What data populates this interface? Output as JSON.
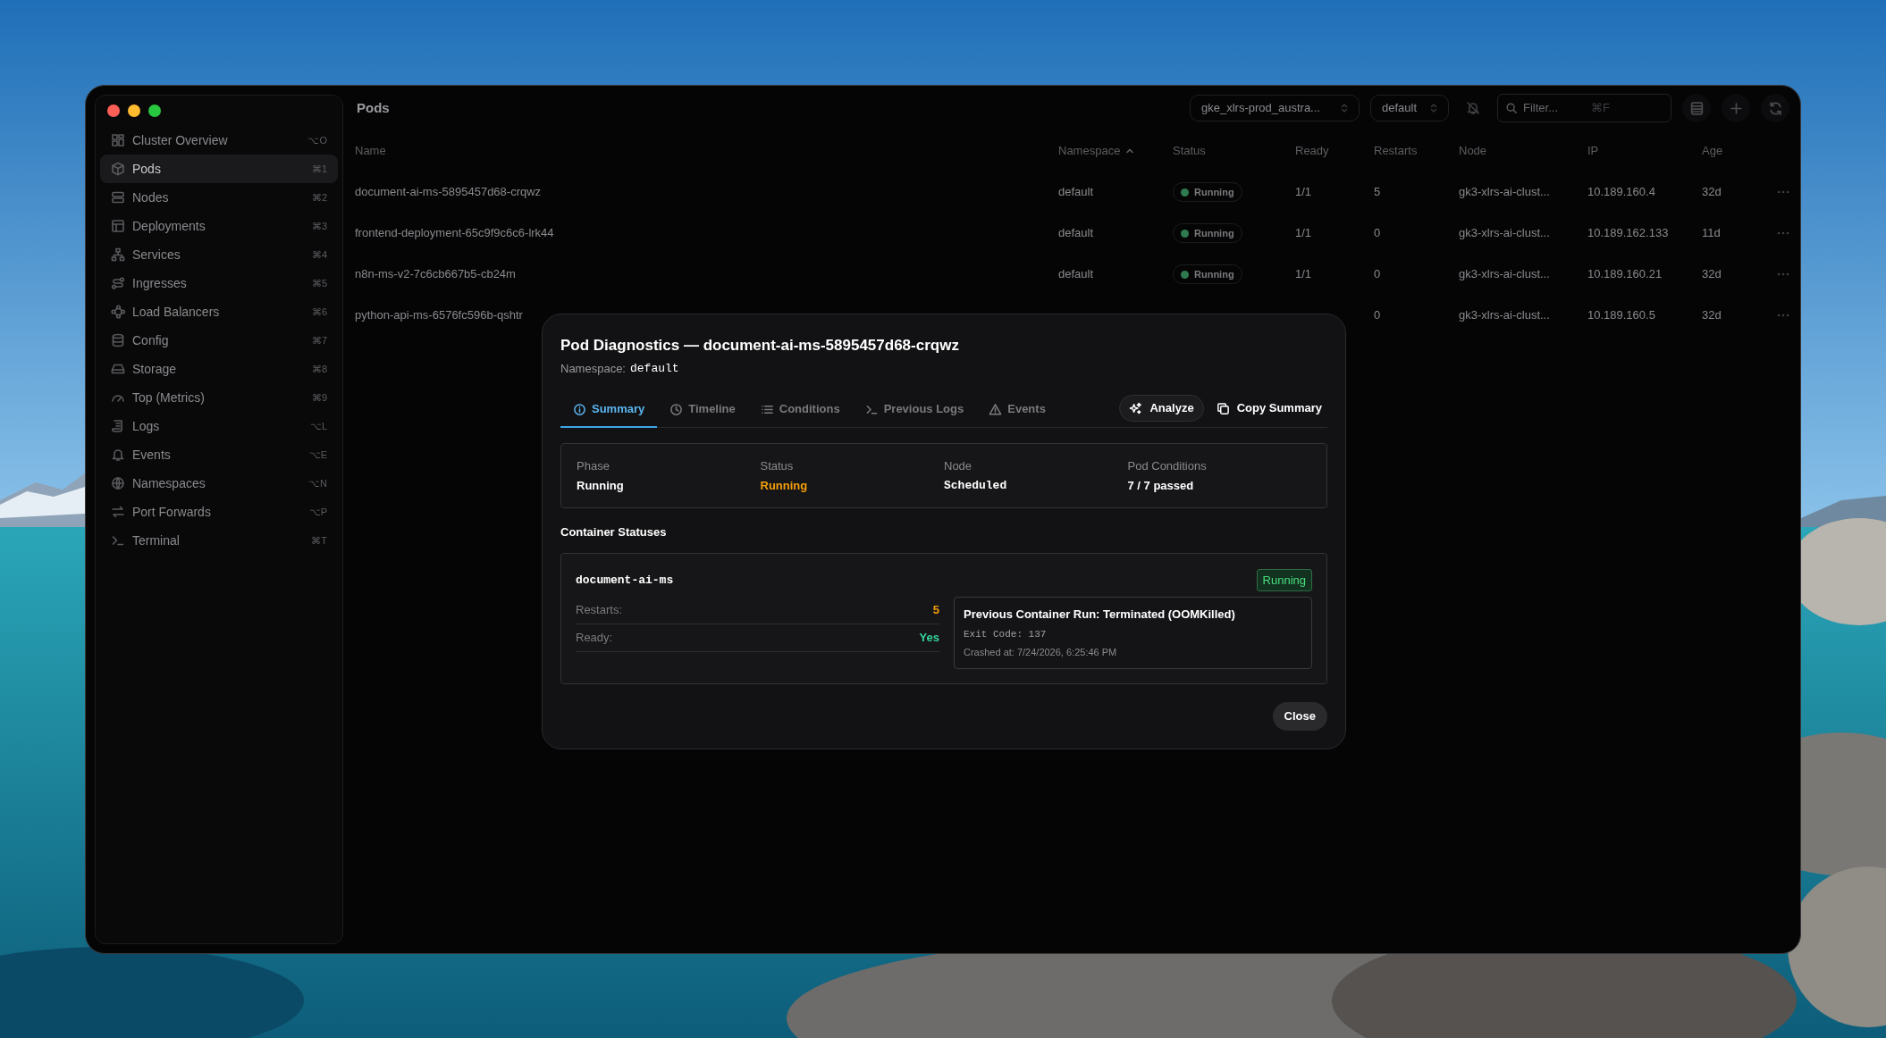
{
  "window": {
    "title": "Pods"
  },
  "sidebar": {
    "items": [
      {
        "label": "Cluster Overview",
        "shortcut": "⌥O",
        "selected": false
      },
      {
        "label": "Pods",
        "shortcut": "⌘1",
        "selected": true
      },
      {
        "label": "Nodes",
        "shortcut": "⌘2",
        "selected": false
      },
      {
        "label": "Deployments",
        "shortcut": "⌘3",
        "selected": false
      },
      {
        "label": "Services",
        "shortcut": "⌘4",
        "selected": false
      },
      {
        "label": "Ingresses",
        "shortcut": "⌘5",
        "selected": false
      },
      {
        "label": "Load Balancers",
        "shortcut": "⌘6",
        "selected": false
      },
      {
        "label": "Config",
        "shortcut": "⌘7",
        "selected": false
      },
      {
        "label": "Storage",
        "shortcut": "⌘8",
        "selected": false
      },
      {
        "label": "Top (Metrics)",
        "shortcut": "⌘9",
        "selected": false
      },
      {
        "label": "Logs",
        "shortcut": "⌥L",
        "selected": false
      },
      {
        "label": "Events",
        "shortcut": "⌥E",
        "selected": false
      },
      {
        "label": "Namespaces",
        "shortcut": "⌥N",
        "selected": false
      },
      {
        "label": "Port Forwards",
        "shortcut": "⌥P",
        "selected": false
      },
      {
        "label": "Terminal",
        "shortcut": "⌘T",
        "selected": false
      }
    ]
  },
  "toolbar": {
    "context": "gke_xlrs-prod_austra...",
    "namespace": "default",
    "filter": {
      "placeholder": "Filter...",
      "shortcut": "⌘F"
    }
  },
  "table": {
    "columns": [
      {
        "label": "Name",
        "sorted": false
      },
      {
        "label": "Namespace",
        "sorted": true
      },
      {
        "label": "Status",
        "sorted": false
      },
      {
        "label": "Ready",
        "sorted": false
      },
      {
        "label": "Restarts",
        "sorted": false
      },
      {
        "label": "Node",
        "sorted": false
      },
      {
        "label": "IP",
        "sorted": false
      },
      {
        "label": "Age",
        "sorted": false
      }
    ],
    "rows": [
      {
        "name": "document-ai-ms-5895457d68-crqwz",
        "namespace": "default",
        "status": "Running",
        "ready": "1/1",
        "restarts": "5",
        "node": "gk3-xlrs-ai-clust...",
        "ip": "10.189.160.4",
        "age": "32d"
      },
      {
        "name": "frontend-deployment-65c9f9c6c6-lrk44",
        "namespace": "default",
        "status": "Running",
        "ready": "1/1",
        "restarts": "0",
        "node": "gk3-xlrs-ai-clust...",
        "ip": "10.189.162.133",
        "age": "11d"
      },
      {
        "name": "n8n-ms-v2-7c6cb667b5-cb24m",
        "namespace": "default",
        "status": "Running",
        "ready": "1/1",
        "restarts": "0",
        "node": "gk3-xlrs-ai-clust...",
        "ip": "10.189.160.21",
        "age": "32d"
      },
      {
        "name": "python-api-ms-6576fc596b-qshtr",
        "restarts": "0",
        "node": "gk3-xlrs-ai-clust...",
        "ip": "10.189.160.5",
        "age": "32d"
      }
    ]
  },
  "dialog": {
    "title": "Pod Diagnostics — document-ai-ms-5895457d68-crqwz",
    "namespace_label": "Namespace:",
    "namespace": "default",
    "tabs": [
      {
        "label": "Summary",
        "selected": true
      },
      {
        "label": "Timeline",
        "selected": false
      },
      {
        "label": "Conditions",
        "selected": false
      },
      {
        "label": "Previous Logs",
        "selected": false
      },
      {
        "label": "Events",
        "selected": false
      }
    ],
    "actions": [
      {
        "label": "Analyze",
        "kind": "outlined"
      },
      {
        "label": "Copy Summary",
        "kind": "plain"
      }
    ],
    "summary": [
      {
        "label": "Phase",
        "value": "Running",
        "kind": "text",
        "color": "#ffffff"
      },
      {
        "label": "Status",
        "value": "Running",
        "kind": "text",
        "color": "#f59e0b"
      },
      {
        "label": "Node",
        "value": "Scheduled",
        "kind": "mono",
        "color": "#ffffff"
      },
      {
        "label": "Pod Conditions",
        "value": "7 / 7 passed",
        "kind": "text",
        "color": "#ffffff"
      }
    ],
    "section_title": "Container Statuses",
    "container": {
      "name": "document-ai-ms",
      "state": "Running",
      "fields": [
        {
          "label": "Restarts:",
          "value": "5",
          "color": "#f59e0b"
        },
        {
          "label": "Ready:",
          "value": "Yes",
          "color": "#34d399"
        }
      ],
      "previous_run": {
        "title": "Previous Container Run: Terminated (OOMKilled)",
        "exit_code": "Exit Code: 137",
        "crashed_at": "Crashed at: 7/24/2026, 6:25:46 PM"
      }
    },
    "close": "Close"
  }
}
